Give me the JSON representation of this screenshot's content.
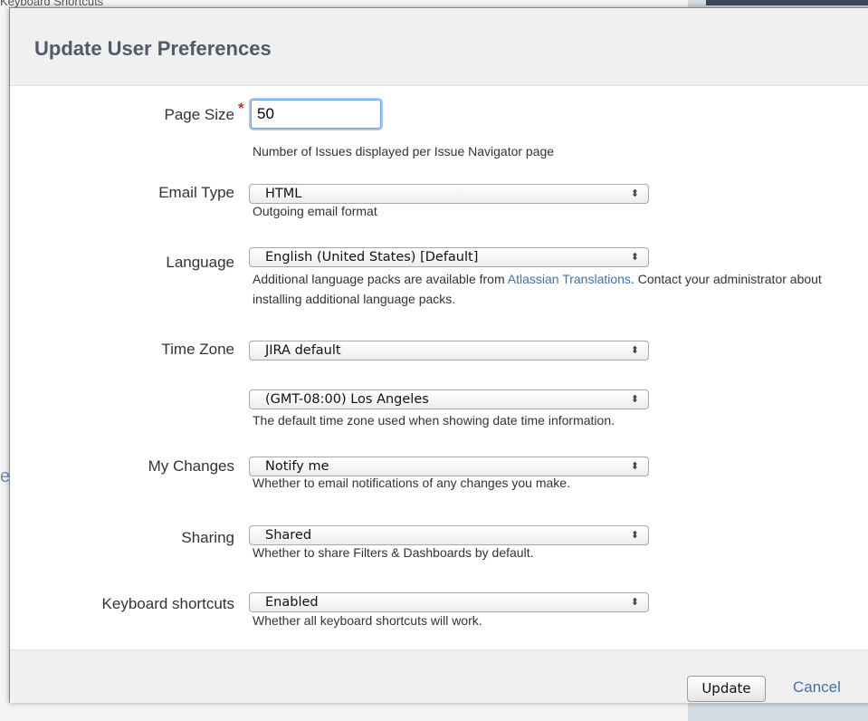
{
  "background": {
    "caption": "Keyboard Shortcuts",
    "edge_letter": "e"
  },
  "dialog": {
    "title": "Update User Preferences"
  },
  "fields": {
    "page_size": {
      "label": "Page Size",
      "required_mark": "*",
      "value": "50",
      "help": "Number of Issues displayed per Issue Navigator page"
    },
    "email_type": {
      "label": "Email Type",
      "selected": "HTML",
      "help": "Outgoing email format"
    },
    "language": {
      "label": "Language",
      "selected": "English (United States) [Default]",
      "help_before": "Additional language packs are available from ",
      "help_link": "Atlassian Translations",
      "help_after": ". Contact your administrator about installing additional language packs."
    },
    "time_zone": {
      "label": "Time Zone",
      "region_selected": "JIRA default",
      "zone_selected": "(GMT-08:00) Los Angeles",
      "help": "The default time zone used when showing date time information."
    },
    "my_changes": {
      "label": "My Changes",
      "selected": "Notify me",
      "help": "Whether to email notifications of any changes you make."
    },
    "sharing": {
      "label": "Sharing",
      "selected": "Shared",
      "help": "Whether to share Filters & Dashboards by default."
    },
    "keyboard_shortcuts": {
      "label": "Keyboard shortcuts",
      "selected": "Enabled",
      "help": "Whether all keyboard shortcuts will work."
    }
  },
  "footer": {
    "update_label": "Update",
    "cancel_label": "Cancel"
  },
  "icons": {
    "select_arrow": "updown-chevron-icon"
  },
  "colors": {
    "link": "#3b73af",
    "required": "#cc3333",
    "title": "#505a6b",
    "header_bg": "#f0f0f0"
  }
}
